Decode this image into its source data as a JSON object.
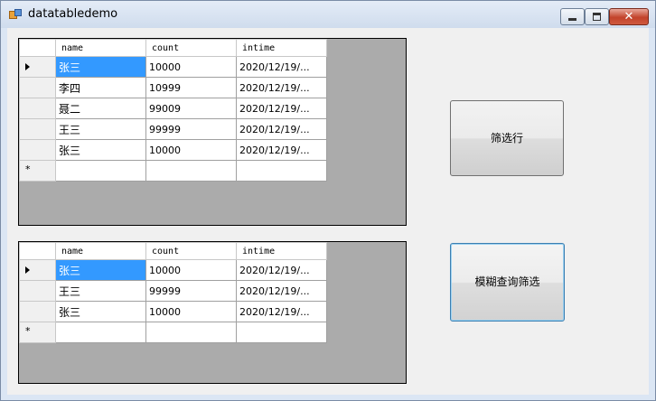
{
  "window": {
    "title": "datatabledemo",
    "close_glyph": "✕"
  },
  "grid_top": {
    "columns": [
      "name",
      "count",
      "intime"
    ],
    "rows": [
      {
        "name": "张三",
        "count": "10000",
        "intime": "2020/12/19/..."
      },
      {
        "name": "李四",
        "count": "10999",
        "intime": "2020/12/19/..."
      },
      {
        "name": "聂二",
        "count": "99009",
        "intime": "2020/12/19/..."
      },
      {
        "name": "王三",
        "count": "99999",
        "intime": "2020/12/19/..."
      },
      {
        "name": "张三",
        "count": "10000",
        "intime": "2020/12/19/..."
      }
    ],
    "new_row_marker": "*"
  },
  "grid_bottom": {
    "columns": [
      "name",
      "count",
      "intime"
    ],
    "rows": [
      {
        "name": "张三",
        "count": "10000",
        "intime": "2020/12/19/..."
      },
      {
        "name": "王三",
        "count": "99999",
        "intime": "2020/12/19/..."
      },
      {
        "name": "张三",
        "count": "10000",
        "intime": "2020/12/19/..."
      }
    ],
    "new_row_marker": "*"
  },
  "buttons": {
    "filter_rows": "筛选行",
    "fuzzy_filter": "模糊查询筛选"
  },
  "colors": {
    "selection": "#3399ff",
    "grid_background": "#ababab",
    "form_background": "#f0f0f0"
  }
}
